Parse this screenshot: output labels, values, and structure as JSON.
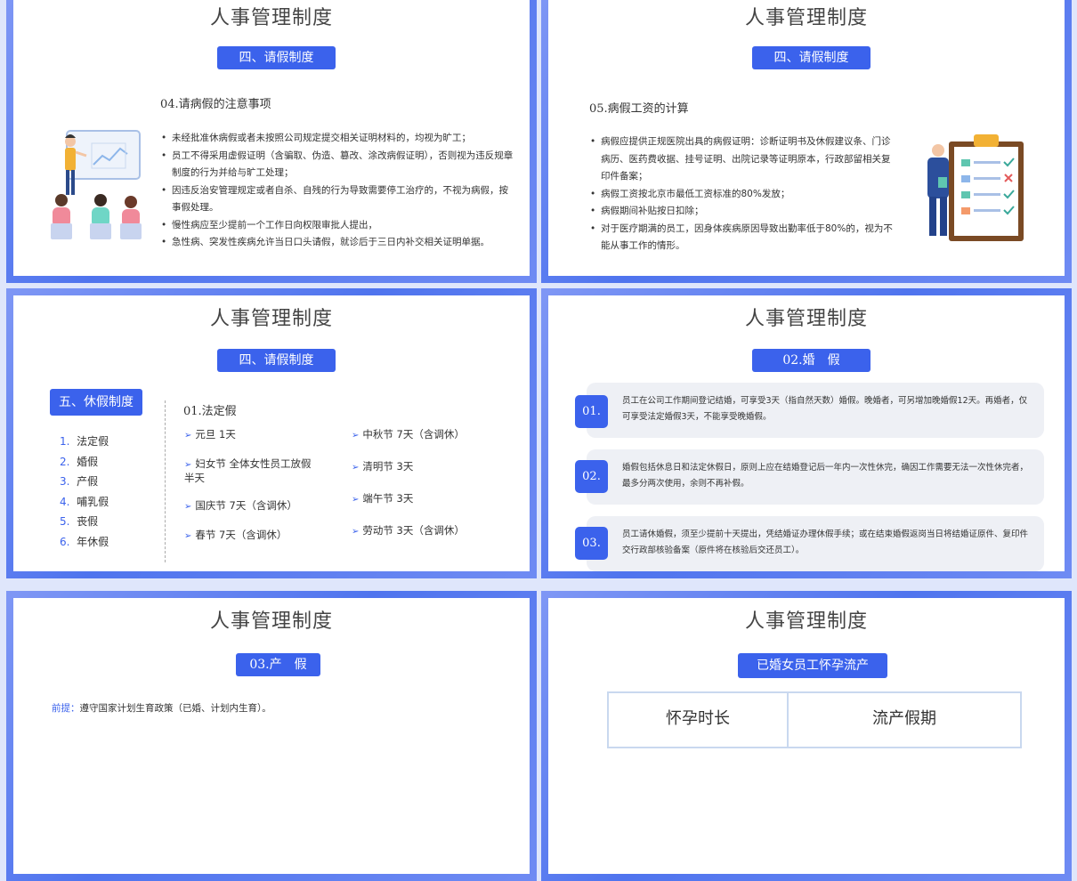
{
  "colors": {
    "accent": "#3b62ec",
    "card": "#eef0f5"
  },
  "slides": [
    {
      "title": "人事管理制度",
      "pill": "四、请假制度",
      "subtitle": "04.请病假的注意事项",
      "bullets": [
        "未经批准休病假或者未按照公司规定提交相关证明材料的，均视为旷工；",
        "员工不得采用虚假证明（含骗取、伪造、篡改、涂改病假证明），否则视为违反规章制度的行为并给与旷工处理；",
        "因违反治安管理规定或者自杀、自残的行为导致需要停工治疗的，不视为病假，按事假处理。",
        "慢性病应至少提前一个工作日向权限审批人提出，",
        "急性病、突发性疾病允许当日口头请假，就诊后于三日内补交相关证明单据。"
      ]
    },
    {
      "title": "人事管理制度",
      "pill": "四、请假制度",
      "subtitle": "05.病假工资的计算",
      "bullets": [
        "病假应提供正规医院出具的病假证明：诊断证明书及休假建议条、门诊病历、医药费收据、挂号证明、出院记录等证明原本，行政部留相关复印件备案；",
        "病假工资按北京市最低工资标准的80%发放；",
        "病假期间补贴按日扣除；",
        "对于医疗期满的员工，因身体疾病原因导致出勤率低于80%的，视为不能从事工作的情形。"
      ]
    },
    {
      "title": "人事管理制度",
      "pill": "四、请假制度",
      "side_title": "五、休假制度",
      "side_items": [
        {
          "num": "1.",
          "label": "法定假"
        },
        {
          "num": "2.",
          "label": "婚假"
        },
        {
          "num": "3.",
          "label": "产假"
        },
        {
          "num": "4.",
          "label": "哺乳假"
        },
        {
          "num": "5.",
          "label": "丧假"
        },
        {
          "num": "6.",
          "label": "年休假"
        }
      ],
      "subtitle": "01.法定假",
      "holidays_left": [
        "元旦 1天",
        "妇女节 全体女性员工放假半天",
        "国庆节 7天（含调休）",
        "春节 7天（含调休）"
      ],
      "holidays_right": [
        "中秋节 7天（含调休）",
        "清明节 3天",
        "端午节 3天",
        "劳动节 3天（含调休）"
      ],
      "arrow": "➢"
    },
    {
      "title": "人事管理制度",
      "pill": "02.婚　假",
      "cards": [
        {
          "num": "01.",
          "text": "员工在公司工作期间登记结婚，可享受3天（指自然天数）婚假。晚婚者，可另增加晚婚假12天。再婚者，仅可享受法定婚假3天，不能享受晚婚假。"
        },
        {
          "num": "02.",
          "text": "婚假包括休息日和法定休假日，原则上应在结婚登记后一年内一次性休完，确因工作需要无法一次性休完者，最多分两次使用，余则不再补假。"
        },
        {
          "num": "03.",
          "text": "员工请休婚假，须至少提前十天提出，凭结婚证办理休假手续；或在结束婚假返岗当日将结婚证原件、复印件交行政部核验备案（原件将在核验后交还员工）。"
        }
      ]
    },
    {
      "title": "人事管理制度",
      "pill": "03.产　假",
      "premise_label": "前提：",
      "premise_text": "遵守国家计划生育政策（已婚、计划内生育）。"
    },
    {
      "title": "人事管理制度",
      "pill": "已婚女员工怀孕流产",
      "table_headers": [
        "怀孕时长",
        "流产假期"
      ]
    }
  ]
}
